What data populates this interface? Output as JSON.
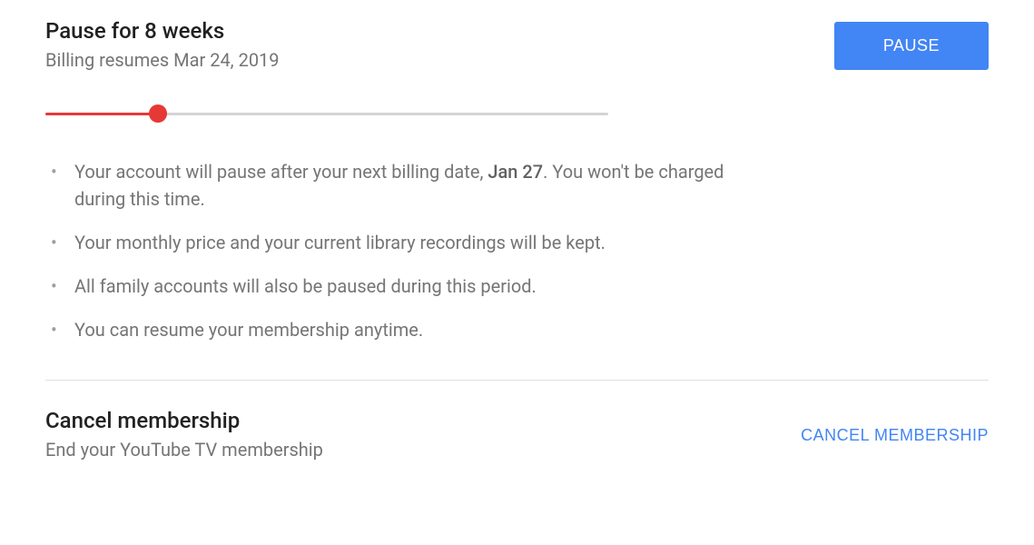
{
  "pause": {
    "title": "Pause for 8 weeks",
    "subtitle": "Billing resumes Mar 24, 2019",
    "button_label": "PAUSE",
    "slider_percent": 20,
    "info": {
      "item1_pre": "Your account will pause after your next billing date, ",
      "item1_date": "Jan 27",
      "item1_post": ". You won't be charged during this time.",
      "item2": "Your monthly price and your current library recordings will be kept.",
      "item3": "All family accounts will also be paused during this period.",
      "item4": "You can resume your membership anytime."
    }
  },
  "cancel": {
    "title": "Cancel membership",
    "subtitle": "End your YouTube TV membership",
    "button_label": "CANCEL MEMBERSHIP"
  }
}
